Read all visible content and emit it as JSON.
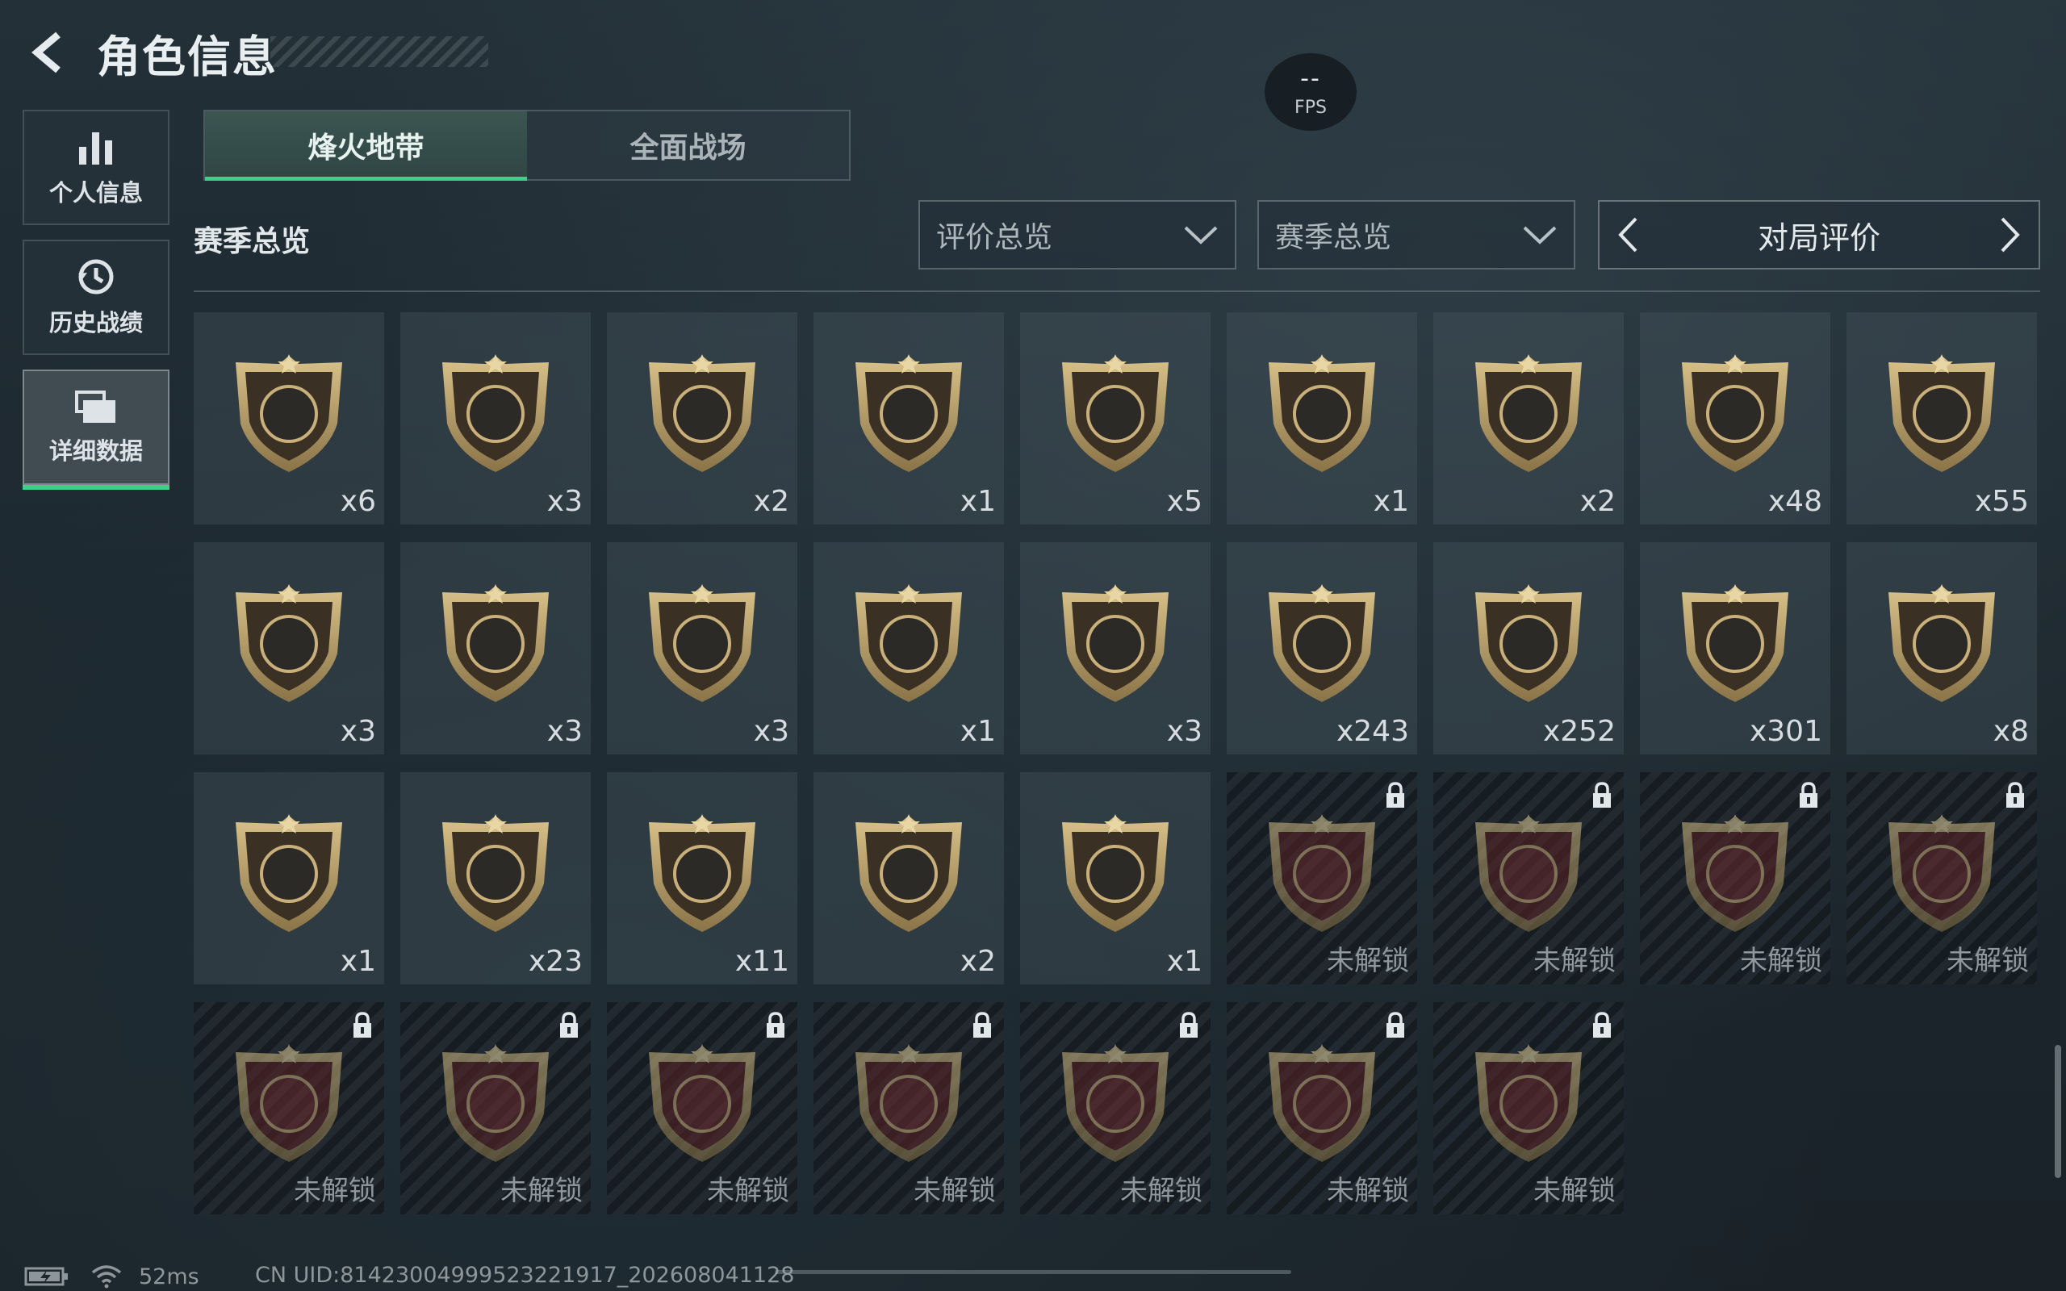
{
  "header": {
    "title": "角色信息"
  },
  "fps": {
    "value": "--",
    "label": "FPS"
  },
  "sidenav": {
    "items": [
      {
        "label": "个人信息",
        "icon": "bar-chart-icon"
      },
      {
        "label": "历史战绩",
        "icon": "history-icon"
      },
      {
        "label": "详细数据",
        "icon": "folder-icon",
        "active": true
      }
    ]
  },
  "tabs": [
    {
      "label": "烽火地带",
      "active": true
    },
    {
      "label": "全面战场",
      "active": false
    }
  ],
  "section_title": "赛季总览",
  "filters": {
    "evaluation": "评价总览",
    "season": "赛季总览"
  },
  "pager": {
    "label": "对局评价"
  },
  "grid": [
    {
      "icon": "diamond-badge-icon",
      "count": "x6"
    },
    {
      "icon": "tank-badge-icon",
      "count": "x3"
    },
    {
      "icon": "server-badge-icon",
      "count": "x2"
    },
    {
      "icon": "carbon-sheet-badge-icon",
      "count": "x1"
    },
    {
      "icon": "circuit-board-badge-icon",
      "count": "x5"
    },
    {
      "icon": "robot-vacuum-badge-icon",
      "count": "x1"
    },
    {
      "icon": "painting-badge-icon",
      "count": "x2"
    },
    {
      "icon": "assault-rifle-badge-icon",
      "count": "x48"
    },
    {
      "icon": "smg-badge-icon",
      "count": "x55"
    },
    {
      "icon": "shotgun-badge-icon",
      "count": "x3"
    },
    {
      "icon": "rifle-badge-icon",
      "count": "x3"
    },
    {
      "icon": "marksman-rifle-badge-icon",
      "count": "x3"
    },
    {
      "icon": "sniper-badge-icon",
      "count": "x1"
    },
    {
      "icon": "pistol-badge-icon",
      "count": "x3"
    },
    {
      "icon": "knife-badge-icon",
      "count": "x243"
    },
    {
      "icon": "skull-badge-icon",
      "count": "x252"
    },
    {
      "icon": "emblem-badge-icon",
      "count": "x301"
    },
    {
      "icon": "laurel-badge-icon",
      "count": "x8"
    },
    {
      "icon": "soldier-badge-icon",
      "count": "x1"
    },
    {
      "icon": "hooded-badge-icon",
      "count": "x23"
    },
    {
      "icon": "agent-badge-icon",
      "count": "x11"
    },
    {
      "icon": "eyepatch-badge-icon",
      "count": "x2"
    },
    {
      "icon": "masked-badge-icon",
      "count": "x1"
    },
    {
      "icon": "orb-badge-icon",
      "count": "未解锁",
      "locked": true
    },
    {
      "icon": "computer-badge-icon",
      "count": "未解锁",
      "locked": true
    },
    {
      "icon": "ammo-box-badge-icon",
      "count": "未解锁",
      "locked": true
    },
    {
      "icon": "reactor-badge-icon",
      "count": "未解锁",
      "locked": true
    },
    {
      "icon": "jewel-box-badge-icon",
      "count": "未解锁",
      "locked": true
    },
    {
      "icon": "chess-box-badge-icon",
      "count": "未解锁",
      "locked": true
    },
    {
      "icon": "device-badge-icon",
      "count": "未解锁",
      "locked": true
    },
    {
      "icon": "canister-badge-icon",
      "count": "未解锁",
      "locked": true
    },
    {
      "icon": "crystal-badge-icon",
      "count": "未解锁",
      "locked": true
    },
    {
      "icon": "officer-badge-icon",
      "count": "未解锁",
      "locked": true
    },
    {
      "icon": "bald-badge-icon",
      "count": "未解锁",
      "locked": true
    }
  ],
  "status": {
    "ping": "52ms",
    "uid": "CN UID:8142300499952322191​7_202608041128"
  }
}
